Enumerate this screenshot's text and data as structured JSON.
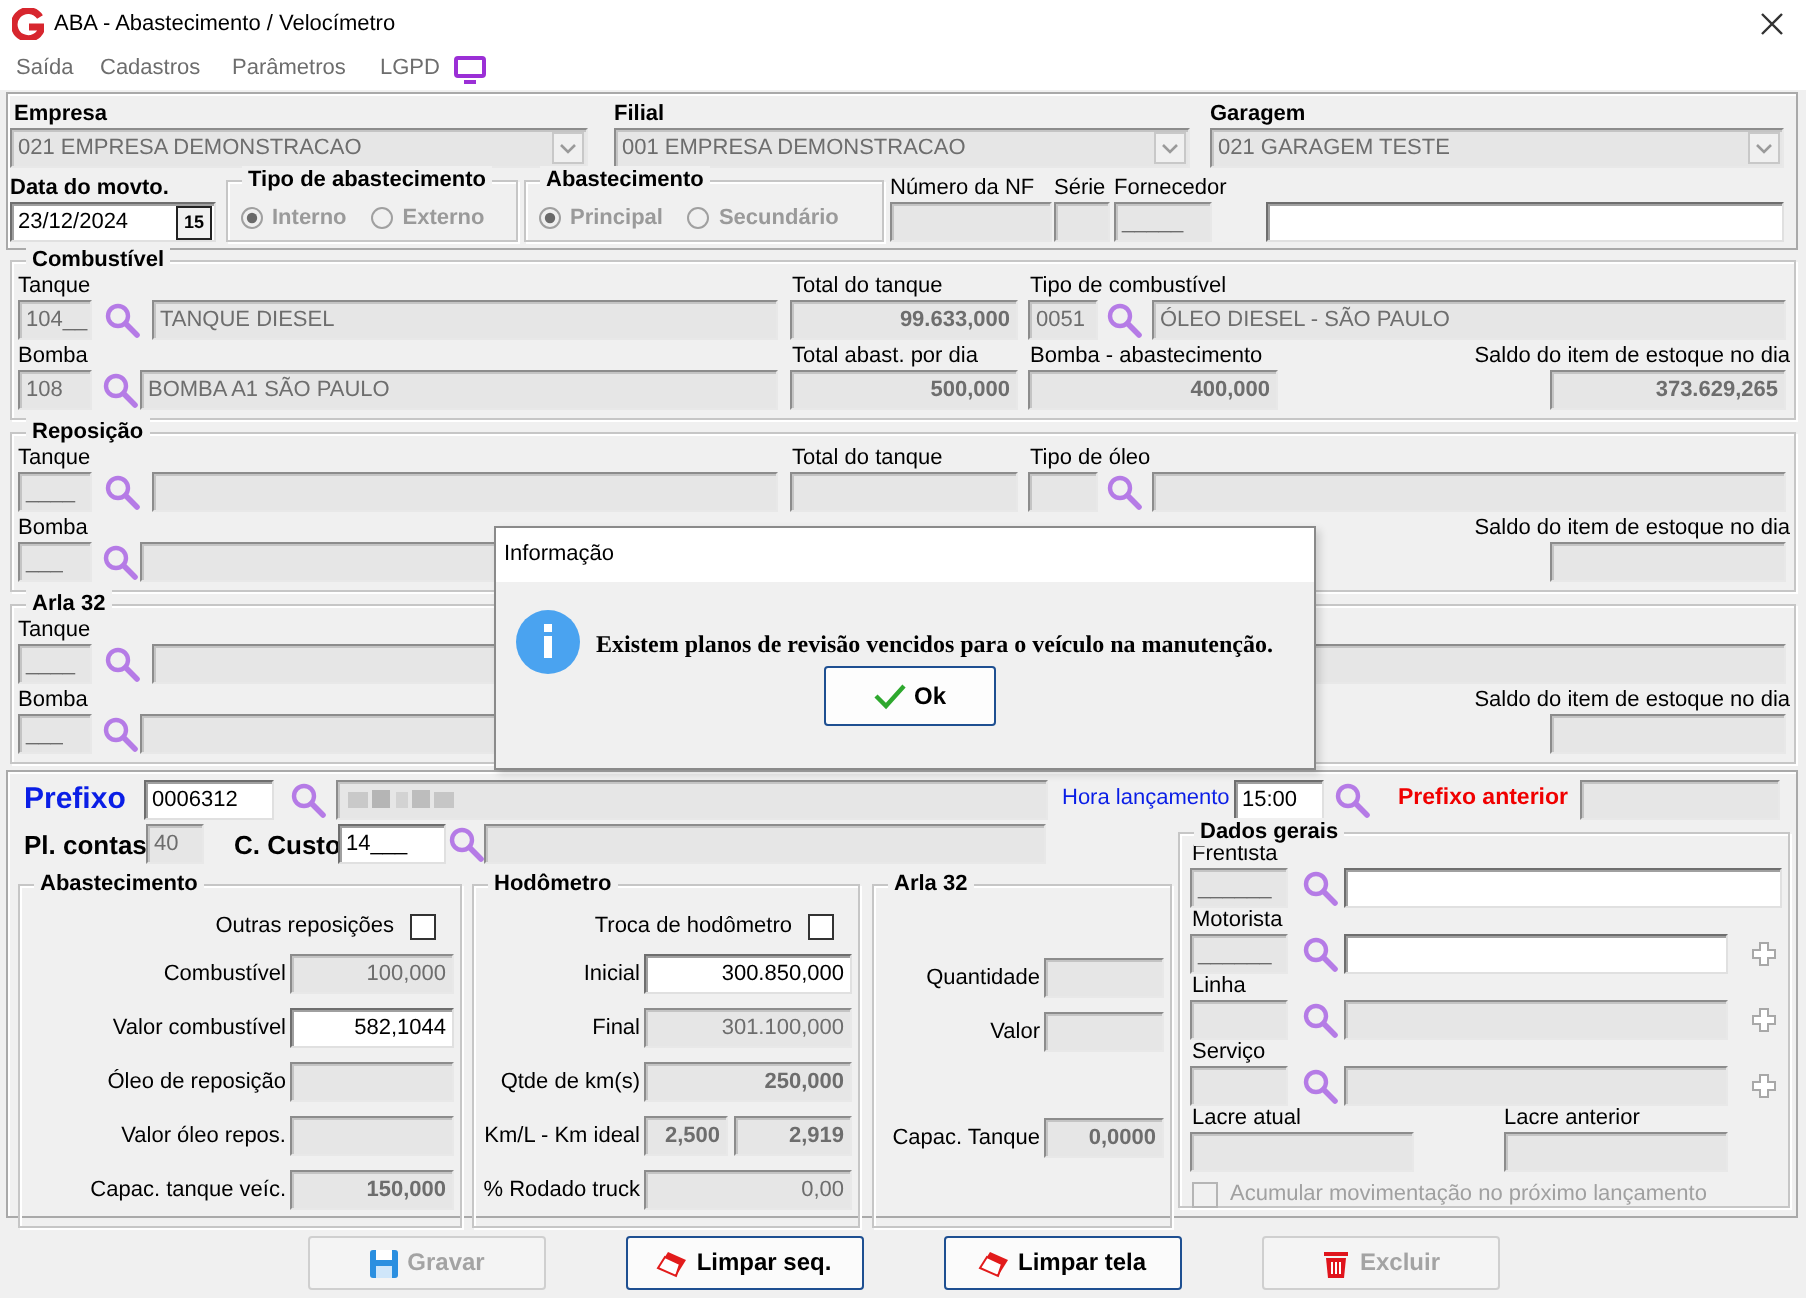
{
  "window": {
    "title": "ABA - Abastecimento / Velocímetro"
  },
  "menu": [
    {
      "label": "Saída"
    },
    {
      "label": "Cadastros"
    },
    {
      "label": "Parâmetros"
    },
    {
      "label": "LGPD"
    }
  ],
  "header": {
    "empresa": {
      "label": "Empresa",
      "field": {
        "value": "021 EMPRESA DEMONSTRACAO",
        "enabled": false
      }
    },
    "filial": {
      "label": "Filial",
      "field": {
        "value": "001 EMPRESA DEMONSTRACAO",
        "enabled": false
      }
    },
    "garagem": {
      "label": "Garagem",
      "field": {
        "value": "021 GARAGEM TESTE",
        "enabled": false
      }
    },
    "data": {
      "label": "Data do movto.",
      "field": {
        "value": "23/12/2024",
        "enabled": true
      },
      "calendar": "15"
    },
    "tipo": {
      "label": "Tipo de abastecimento",
      "options": [
        {
          "label": "Interno",
          "selected": true,
          "disabled": true
        },
        {
          "label": "Externo",
          "selected": false,
          "disabled": true
        }
      ]
    },
    "abastecimento": {
      "label": "Abastecimento",
      "options": [
        {
          "label": "Principal",
          "selected": true,
          "disabled": true
        },
        {
          "label": "Secundário",
          "selected": false,
          "disabled": true
        }
      ]
    },
    "nf": {
      "label": "Número da NF",
      "field": {
        "enabled": false
      }
    },
    "serie": {
      "label": "Série",
      "field": {
        "enabled": false
      }
    },
    "fornecedor": {
      "label": "Fornecedor",
      "field": {
        "value": "_____",
        "enabled": false
      }
    },
    "extra": {
      "field": {
        "enabled": true
      }
    }
  },
  "combustivel": {
    "title": "Combustível",
    "tanque": {
      "label": "Tanque",
      "code": {
        "value": "104__",
        "enabled": false
      },
      "name": {
        "value": "TANQUE DIESEL",
        "enabled": false
      }
    },
    "total_tanque": {
      "label": "Total do tanque",
      "field": {
        "value": "99.633,000",
        "enabled": false,
        "bold": true
      }
    },
    "tipo": {
      "label": "Tipo de combustível",
      "code": {
        "value": "0051",
        "enabled": false
      },
      "name": {
        "value": "ÓLEO DIESEL - SÃO PAULO",
        "enabled": false
      }
    },
    "bomba": {
      "label": "Bomba",
      "code": {
        "value": "108",
        "enabled": false
      },
      "name": {
        "value": "BOMBA A1 SÃO PAULO",
        "enabled": false
      }
    },
    "total_dia": {
      "label": "Total abast. por dia",
      "field": {
        "value": "500,000",
        "enabled": false,
        "bold": true
      }
    },
    "bomba_total": {
      "label": "Bomba - abastecimento",
      "field": {
        "value": "400,000",
        "enabled": false,
        "bold": true
      }
    },
    "saldo": {
      "label": "Saldo do item de estoque no dia",
      "field": {
        "value": "373.629,265",
        "enabled": false,
        "bold": true
      }
    }
  },
  "reposicao": {
    "title": "Reposição",
    "tanque": {
      "label": "Tanque",
      "code": {
        "value": "____",
        "enabled": false
      },
      "name": {
        "enabled": false
      }
    },
    "total_tanque": {
      "label": "Total do tanque",
      "field": {
        "enabled": false
      }
    },
    "tipo": {
      "label": "Tipo de óleo",
      "code": {
        "enabled": false
      },
      "name": {
        "enabled": false
      }
    },
    "bomba": {
      "label": "Bomba",
      "code": {
        "value": "___",
        "enabled": false
      },
      "name": {
        "enabled": false
      }
    },
    "saldo": {
      "label": "Saldo do item de estoque no dia",
      "field": {
        "enabled": false
      }
    }
  },
  "arla": {
    "title": "Arla 32",
    "tanque": {
      "label": "Tanque",
      "code": {
        "value": "____",
        "enabled": false
      },
      "name": {
        "enabled": false
      }
    },
    "bomba": {
      "label": "Bomba",
      "code": {
        "value": "___",
        "enabled": false
      },
      "name": {
        "enabled": false
      }
    },
    "saldo": {
      "label": "Saldo do item de estoque no dia",
      "field": {
        "enabled": false
      }
    }
  },
  "lancamento": {
    "prefixo": {
      "label": "Prefixo",
      "field": {
        "value": "0006312",
        "enabled": true
      },
      "name": {
        "enabled": false
      }
    },
    "hora": {
      "label": "Hora lançamento",
      "field": {
        "value": "15:00",
        "enabled": true
      }
    },
    "prefixo_anterior": {
      "label": "Prefixo anterior",
      "field": {
        "enabled": false
      }
    },
    "pl_contas": {
      "label": "Pl. contas",
      "field": {
        "value": "40",
        "enabled": false
      }
    },
    "c_custo": {
      "label": "C. Custo",
      "field": {
        "value": "14___",
        "enabled": true
      },
      "name": {
        "enabled": false
      }
    }
  },
  "abastecimento": {
    "title": "Abastecimento",
    "check": {
      "label": "Outras reposições",
      "checked": false
    },
    "rows": [
      {
        "label": "Combustível",
        "fields": [
          {
            "value": "100,000",
            "enabled": false
          }
        ]
      },
      {
        "label": "Valor combustível",
        "fields": [
          {
            "value": "582,1044",
            "enabled": true
          }
        ]
      },
      {
        "label": "Óleo de reposição",
        "fields": [
          {
            "enabled": false
          }
        ]
      },
      {
        "label": "Valor óleo repos.",
        "fields": [
          {
            "enabled": false
          }
        ]
      },
      {
        "label": "Capac. tanque veíc.",
        "fields": [
          {
            "value": "150,000",
            "enabled": false,
            "bold": true
          }
        ]
      }
    ]
  },
  "hodometro": {
    "title": "Hodômetro",
    "check": {
      "label": "Troca de hodômetro",
      "checked": false
    },
    "rows": [
      {
        "label": "Inicial",
        "fields": [
          {
            "value": "300.850,000",
            "enabled": true
          }
        ]
      },
      {
        "label": "Final",
        "fields": [
          {
            "value": "301.100,000",
            "enabled": false
          }
        ]
      },
      {
        "label": "Qtde de km(s)",
        "fields": [
          {
            "value": "250,000",
            "enabled": false,
            "bold": true
          }
        ]
      },
      {
        "label": "Km/L - Km ideal",
        "fields": [
          {
            "value": "2,500",
            "enabled": false,
            "bold": true
          },
          {
            "value": "2,919",
            "enabled": false,
            "bold": true
          }
        ]
      },
      {
        "label": "% Rodado truck",
        "fields": [
          {
            "value": "0,00",
            "enabled": false
          }
        ]
      }
    ]
  },
  "arla_lanc": {
    "title": "Arla 32",
    "rows": [
      {
        "label": "Quantidade",
        "fields": [
          {
            "enabled": false
          }
        ]
      },
      {
        "label": "Valor",
        "fields": [
          {
            "enabled": false
          }
        ]
      },
      {
        "label": "Capac. Tanque",
        "fields": [
          {
            "value": "0,0000",
            "enabled": false,
            "bold": true
          }
        ]
      }
    ]
  },
  "dados_gerais": {
    "title": "Dados gerais",
    "rows": [
      {
        "label": "Frentista",
        "code": {
          "value": "______",
          "enabled": false
        },
        "name": {
          "enabled": true
        },
        "add": false
      },
      {
        "label": "Motorista",
        "code": {
          "value": "______",
          "enabled": false
        },
        "name": {
          "enabled": true
        },
        "add": true
      },
      {
        "label": "Linha",
        "code": {
          "enabled": false
        },
        "name": {
          "enabled": false
        },
        "add": true
      },
      {
        "label": "Serviço",
        "code": {
          "enabled": false
        },
        "name": {
          "enabled": false
        },
        "add": true
      }
    ],
    "lacre_atual": {
      "label": "Lacre atual",
      "field": {
        "enabled": false
      }
    },
    "lacre_anterior": {
      "label": "Lacre anterior",
      "field": {
        "enabled": false
      }
    },
    "acumular": {
      "label": "Acumular movimentação no próximo lançamento",
      "checked": false,
      "disabled": true
    }
  },
  "buttons": [
    {
      "label": "Gravar",
      "kind": "save",
      "enabled": false
    },
    {
      "label": "Limpar seq.",
      "kind": "eraser",
      "enabled": true
    },
    {
      "label": "Limpar tela",
      "kind": "eraser",
      "enabled": true
    },
    {
      "label": "Excluir",
      "kind": "trash",
      "enabled": false
    }
  ],
  "dialog": {
    "title": "Informação",
    "message": "Existem planos de revisão vencidos para o veículo na manutenção.",
    "button": "Ok"
  }
}
